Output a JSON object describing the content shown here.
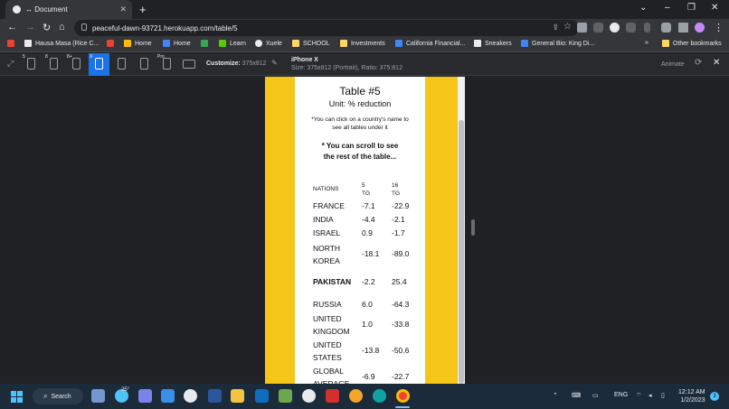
{
  "browser": {
    "tab_title": "↔ Document",
    "url": "peaceful-dawn-93721.herokuapp.com/table/5"
  },
  "bookmarks": {
    "items": [
      "Hausa Masa (Rice C...",
      "Home",
      "Home",
      "Learn",
      "Xuele",
      "SCHOOL",
      "Investments",
      "California Financial...",
      "Sneakers",
      "General Bio: King Di..."
    ],
    "other": "Other bookmarks"
  },
  "devtools": {
    "device_labels": [
      "5",
      "8",
      "8+",
      "X",
      "Pro"
    ],
    "customize_label": "Customize:",
    "customize_value": "375x812",
    "device_name": "iPhone X",
    "device_size": "Size: 375x812 (Portrait), Ratio: 375:812",
    "animate_label": "Animate"
  },
  "page": {
    "title": "Table #5",
    "unit": "Unit: % reduction",
    "note1": "*You can click on a country's name to see all tables under it",
    "note2": "* You can scroll to see the rest of the table...",
    "table": {
      "headers": [
        "NATIONS",
        "5 TG",
        "16 TG"
      ],
      "rows": [
        {
          "nation": "FRANCE",
          "v5": "-7.1",
          "v16": "-22.9"
        },
        {
          "nation": "INDIA",
          "v5": "-4.4",
          "v16": "-2.1"
        },
        {
          "nation": "ISRAEL",
          "v5": "0.9",
          "v16": "-1.7"
        },
        {
          "nation": "NORTH KOREA",
          "v5": "-18.1",
          "v16": "-89.0"
        },
        {
          "nation": "PAKISTAN",
          "v5": "-2.2",
          "v16": "25.4"
        },
        {
          "nation": "RUSSIA",
          "v5": "6.0",
          "v16": "-64.3"
        },
        {
          "nation": "UNITED KINGDOM",
          "v5": "1.0",
          "v16": "-33.8"
        },
        {
          "nation": "UNITED STATES",
          "v5": "-13.8",
          "v16": "-50.6"
        },
        {
          "nation": "GLOBAL AVERAGE",
          "v5": "-6.9",
          "v16": "-22.7"
        }
      ]
    }
  },
  "taskbar": {
    "search_label": "Search",
    "weather": "25°",
    "lang": "ENG",
    "time": "12:12 AM",
    "date": "1/2/2023",
    "badge": "3"
  },
  "colors": {
    "accent": "#1a73e8",
    "phone_bg": "#f5c518"
  }
}
